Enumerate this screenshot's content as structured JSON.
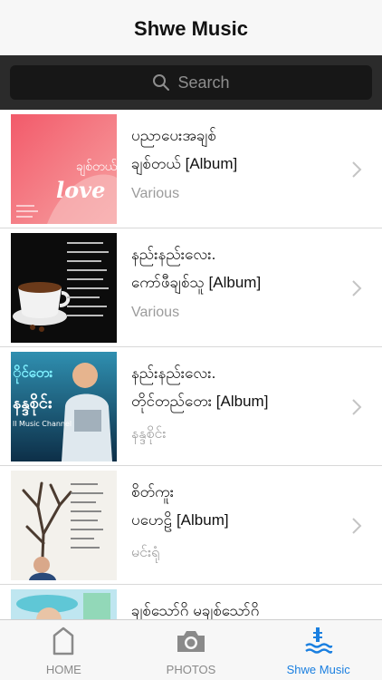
{
  "app": {
    "title": "Shwe Music"
  },
  "search": {
    "placeholder": "Search",
    "icon": "search-icon"
  },
  "albums": [
    {
      "title": "ပညာပေးအချစ်",
      "subtitle": "ချစ်တယ် [Album]",
      "artist": "Various",
      "art_text": "ချစ်တယ် Love"
    },
    {
      "title": "နည်းနည်းလေး.",
      "subtitle": " ကော်ဖီချစ်သူ [Album]",
      "artist": "Various",
      "art_text": ""
    },
    {
      "title": "နည်းနည်းလေး.",
      "subtitle": "တိုင်တည်တေး [Album]",
      "artist": "နန္ဒစိုင်း",
      "art_text": "နန္ဒစိုင်း ll Music Channel"
    },
    {
      "title": "စိတ်ကူး",
      "subtitle": "ပဟေဠိ [Album]",
      "artist": "မင်းရုံ",
      "art_text": ""
    },
    {
      "title": "ချစ်သော်ဂိ မချစ်သော်ဂိ",
      "subtitle": "",
      "artist": "",
      "art_text": ""
    }
  ],
  "tabbar": {
    "tabs": [
      {
        "label": "HOME",
        "icon": "home-icon",
        "active": false
      },
      {
        "label": "PHOTOS",
        "icon": "camera-icon",
        "active": false
      },
      {
        "label": "Shwe Music",
        "icon": "music-waves-icon",
        "active": true
      }
    ]
  },
  "colors": {
    "accent": "#1a7fe0",
    "searchbar": "#2b2b2b",
    "secondary_text": "#9b9b9b"
  }
}
